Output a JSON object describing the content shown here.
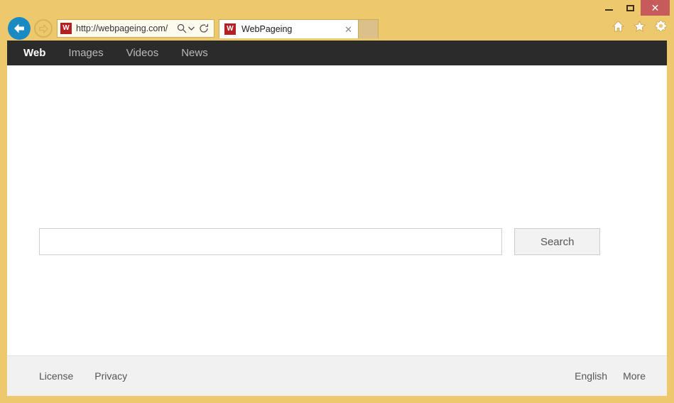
{
  "window": {
    "controls": {
      "minimize": "minimize-icon",
      "maximize": "maximize-icon",
      "close_label": "✕"
    },
    "frame_color": "#edc86c",
    "close_button_color": "#c75b5b"
  },
  "browser": {
    "back_label": "back-arrow-icon",
    "forward_label": "forward-arrow-icon",
    "address": {
      "favicon_letter": "W",
      "url": "http://webpageing.com/",
      "search_icon": "magnifier-icon",
      "dropdown_icon": "chevron-down-icon",
      "refresh_icon": "refresh-icon"
    },
    "tabs": [
      {
        "favicon_letter": "W",
        "title": "WebPageing",
        "close_label": "✕",
        "active": true
      }
    ],
    "new_tab_label": "new-tab-button",
    "toolbar_icons": [
      {
        "name": "home-icon"
      },
      {
        "name": "favorites-star-icon"
      },
      {
        "name": "settings-gear-icon"
      }
    ],
    "loading_bar_color": "#e01b0b"
  },
  "page": {
    "nav": {
      "items": [
        {
          "label": "Web",
          "active": true
        },
        {
          "label": "Images",
          "active": false
        },
        {
          "label": "Videos",
          "active": false
        },
        {
          "label": "News",
          "active": false
        }
      ],
      "background": "#2b2b2b"
    },
    "search": {
      "value": "",
      "placeholder": "",
      "button_label": "Search"
    },
    "footer": {
      "left_links": [
        "License",
        "Privacy"
      ],
      "right_links": [
        "English",
        "More"
      ]
    }
  }
}
